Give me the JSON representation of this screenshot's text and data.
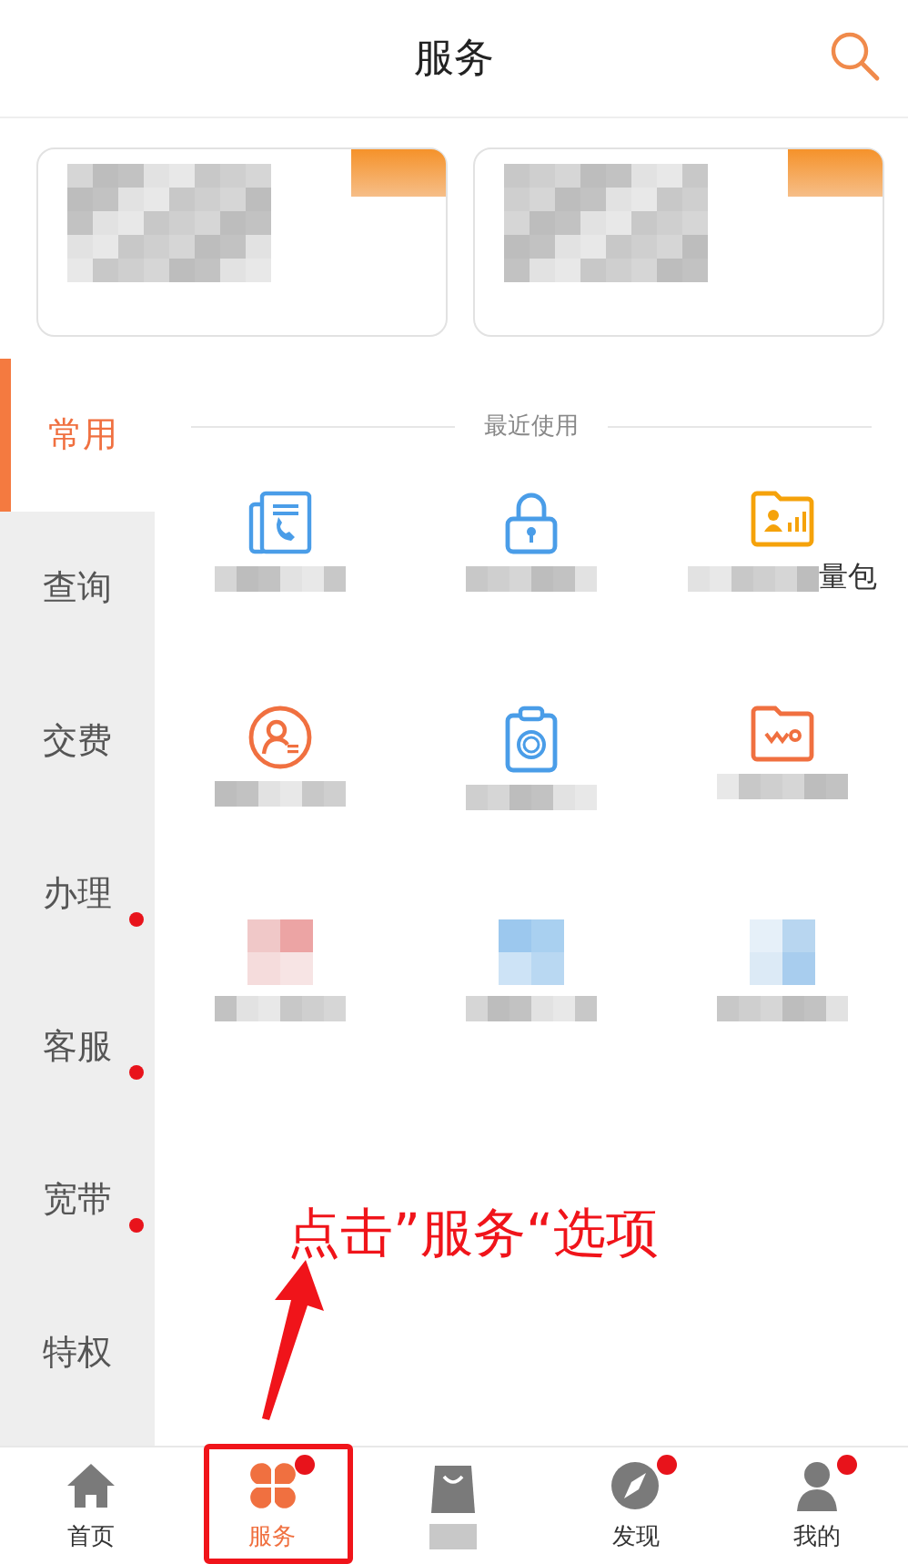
{
  "header": {
    "title": "服务"
  },
  "banners": [
    {
      "kind": "blurred"
    },
    {
      "kind": "blurred"
    }
  ],
  "sidebar": [
    {
      "label": "常用",
      "selected": true,
      "dot": false
    },
    {
      "label": "查询",
      "selected": false,
      "dot": false
    },
    {
      "label": "交费",
      "selected": false,
      "dot": false
    },
    {
      "label": "办理",
      "selected": false,
      "dot": true
    },
    {
      "label": "客服",
      "selected": false,
      "dot": true
    },
    {
      "label": "宽带",
      "selected": false,
      "dot": true
    },
    {
      "label": "特权",
      "selected": false,
      "dot": false
    }
  ],
  "section_title": "最近使用",
  "services": [
    {
      "kind": "phonebook"
    },
    {
      "kind": "lock"
    },
    {
      "kind": "data-folder",
      "label": "量包"
    },
    {
      "kind": "person-circle"
    },
    {
      "kind": "clipboard"
    },
    {
      "kind": "wo-folder"
    },
    {
      "kind": "blurred-red"
    },
    {
      "kind": "blurred-calendar"
    },
    {
      "kind": "blurred-blue"
    }
  ],
  "nav": [
    {
      "kind": "home",
      "label": "首页",
      "selected": false,
      "badge": false
    },
    {
      "kind": "clover",
      "label": "服务",
      "selected": true,
      "badge": true
    },
    {
      "kind": "bag",
      "selected": false,
      "badge": false
    },
    {
      "kind": "compass",
      "label": "发现",
      "selected": false,
      "badge": true
    },
    {
      "kind": "person",
      "label": "我的",
      "selected": false,
      "badge": true
    }
  ],
  "annotation": {
    "text": "点击”服务“选项"
  }
}
